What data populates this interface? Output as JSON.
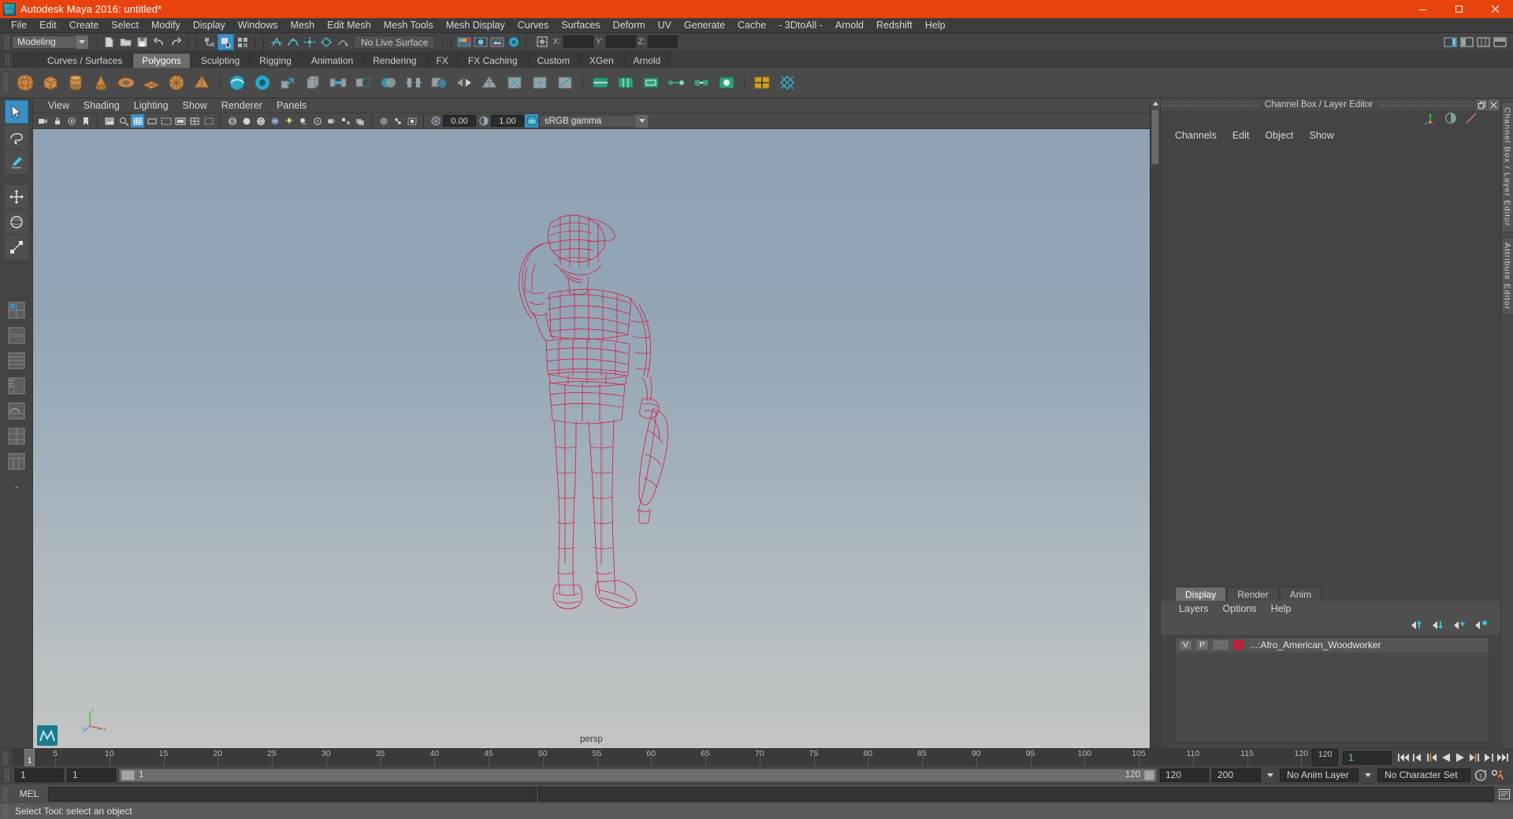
{
  "window": {
    "title": "Autodesk Maya 2016: untitled*",
    "logo_icon": "maya-logo-icon",
    "minimize_label": "Minimize",
    "maximize_label": "Restore",
    "close_label": "Close"
  },
  "menubar": {
    "items": [
      "File",
      "Edit",
      "Create",
      "Select",
      "Modify",
      "Display",
      "Windows",
      "Mesh",
      "Edit Mesh",
      "Mesh Tools",
      "Mesh Display",
      "Curves",
      "Surfaces",
      "Deform",
      "UV",
      "Generate",
      "Cache",
      "- 3DtoAll -",
      "Arnold",
      "Redshift",
      "Help"
    ]
  },
  "statusline": {
    "mode": "Modeling",
    "live_surface": "No Live Surface",
    "coords": {
      "x_label": "X:",
      "x_value": "",
      "y_label": "Y:",
      "y_value": "",
      "z_label": "Z:",
      "z_value": ""
    },
    "icons": [
      "new-scene-icon",
      "open-scene-icon",
      "save-scene-icon",
      "undo-icon",
      "redo-icon",
      "select-hierarchy-icon",
      "select-object-icon",
      "select-component-icon",
      "snap-grid-icon",
      "snap-curve-icon",
      "snap-point-icon",
      "snap-view-plane-icon",
      "snap-live-icon",
      "render-current-frame-icon",
      "ipr-render-icon",
      "render-settings-icon",
      "hypershade-icon"
    ],
    "right_icons": [
      "show-hide-sidebar-icon",
      "channel-box-toggle-icon",
      "attribute-editor-toggle-icon",
      "tool-settings-toggle-icon"
    ]
  },
  "shelf": {
    "tabs": [
      "Curves / Surfaces",
      "Polygons",
      "Sculpting",
      "Rigging",
      "Animation",
      "Rendering",
      "FX",
      "FX Caching",
      "Custom",
      "XGen",
      "Arnold"
    ],
    "selected_tab": "Polygons",
    "icons": [
      "poly-sphere-icon",
      "poly-cube-icon",
      "poly-cylinder-icon",
      "poly-cone-icon",
      "poly-torus-icon",
      "poly-plane-icon",
      "poly-disc-icon",
      "poly-pyramid-icon",
      "poly-smooth-icon",
      "poly-sculpt-icon",
      "poly-extrude-icon",
      "poly-bevel-icon",
      "poly-bridge-icon",
      "poly-append-icon",
      "poly-combine-icon",
      "poly-separate-icon",
      "poly-booleans-icon",
      "poly-mirror-icon",
      "poly-reduce-icon",
      "poly-triangulate-icon",
      "poly-quadrangulate-icon",
      "poly-split-icon",
      "poly-cut-icon",
      "poly-insert-edge-loop-icon",
      "poly-offset-edge-icon",
      "poly-target-weld-icon",
      "poly-merge-icon",
      "poly-fill-hole-icon",
      "poly-crease-icon",
      "poly-uv-icon"
    ]
  },
  "toolbox": {
    "tools": [
      {
        "name": "select-tool",
        "selected": true
      },
      {
        "name": "lasso-select-tool",
        "selected": false
      },
      {
        "name": "paint-select-tool",
        "selected": false
      },
      {
        "name": "move-tool",
        "selected": false
      },
      {
        "name": "rotate-tool",
        "selected": false
      },
      {
        "name": "scale-tool",
        "selected": false
      }
    ],
    "layout_icons": [
      "layout-single-perspective-icon",
      "layout-four-view-icon",
      "layout-two-stacked-icon",
      "layout-persp-outliner-icon",
      "layout-persp-graph-icon",
      "layout-hypershade-icon",
      "layout-three-pane-icon",
      "layout-more-icon"
    ]
  },
  "viewport": {
    "menus": [
      "View",
      "Shading",
      "Lighting",
      "Show",
      "Renderer",
      "Panels"
    ],
    "toolbar_icons": [
      "select-camera-icon",
      "lock-camera-icon",
      "camera-attributes-icon",
      "bookmark-icon",
      "image-plane-icon",
      "two-d-pan-zoom-icon",
      "grid-toggle-icon",
      "film-gate-icon",
      "resolution-gate-icon",
      "gate-mask-icon",
      "field-chart-icon",
      "safe-action-icon",
      "safe-title-icon",
      "wireframe-icon",
      "smooth-shade-icon",
      "shaded-wireframe-icon",
      "textured-icon",
      "lights-icon",
      "shadows-icon",
      "screen-space-ao-icon",
      "motion-blur-icon",
      "multisample-icon",
      "depth-peeling-icon",
      "xray-icon",
      "xray-joints-icon",
      "isolate-select-icon",
      "grid-snap-icon",
      "viewport-settings-icon",
      "exposure-icon",
      "contrast-icon"
    ],
    "exposure_value": "0.00",
    "contrast_value": "1.00",
    "color_management": "sRGB gamma",
    "color_management_toggle": "ON",
    "camera_label": "persp",
    "axis_gizmo": {
      "x": "x",
      "y": "y",
      "z": "z"
    },
    "model_color": "#d41d44",
    "model_name": "Afro American Woodworker wireframe"
  },
  "channel_box": {
    "panel_title": "Channel Box / Layer Editor",
    "menus": [
      "Channels",
      "Edit",
      "Object",
      "Show"
    ],
    "header_icons": [
      "channel-box-icon",
      "attribute-editor-icon",
      "modeling-toolkit-icon"
    ],
    "panel_buttons": [
      "undock-panel-icon",
      "close-panel-icon"
    ]
  },
  "layer_editor": {
    "tabs": [
      "Display",
      "Render",
      "Anim"
    ],
    "selected_tab": "Display",
    "menus": [
      "Layers",
      "Options",
      "Help"
    ],
    "buttons": [
      "move-layer-up-icon",
      "move-layer-down-icon",
      "new-layer-icon",
      "new-layer-from-selected-icon"
    ],
    "layers": [
      {
        "visibility": "V",
        "playback": "P",
        "type": "",
        "color": "#c41d3c",
        "name": "...:Afro_American_Woodworker"
      }
    ]
  },
  "sidebar_tabs": [
    "Channel Box / Layer Editor",
    "Attribute Editor"
  ],
  "timeline": {
    "ticks": [
      5,
      10,
      15,
      20,
      25,
      30,
      35,
      40,
      45,
      50,
      55,
      60,
      65,
      70,
      75,
      80,
      85,
      90,
      95,
      100,
      105,
      110,
      115,
      120
    ],
    "current_frame_marker": "1",
    "end_label": "120",
    "current_frame_field": "1",
    "playback_buttons": [
      "go-to-start-icon",
      "step-back-keyframe-icon",
      "step-back-frame-icon",
      "play-backwards-icon",
      "play-forwards-icon",
      "step-forward-frame-icon",
      "step-forward-keyframe-icon",
      "go-to-end-icon"
    ]
  },
  "range_slider": {
    "anim_start": "1",
    "range_start": "1",
    "bar_start_label": "1",
    "bar_end_label": "120",
    "range_end": "120",
    "anim_end": "200",
    "anim_layer": "No Anim Layer",
    "character_set": "No Character Set",
    "auto_keyframe_icon": "auto-keyframe-icon",
    "animation_prefs_icon": "animation-preferences-icon"
  },
  "command_line": {
    "label": "MEL",
    "input_value": "",
    "output_value": "",
    "script_editor_icon": "script-editor-icon"
  },
  "status_bar": {
    "message": "Select Tool: select an object"
  }
}
